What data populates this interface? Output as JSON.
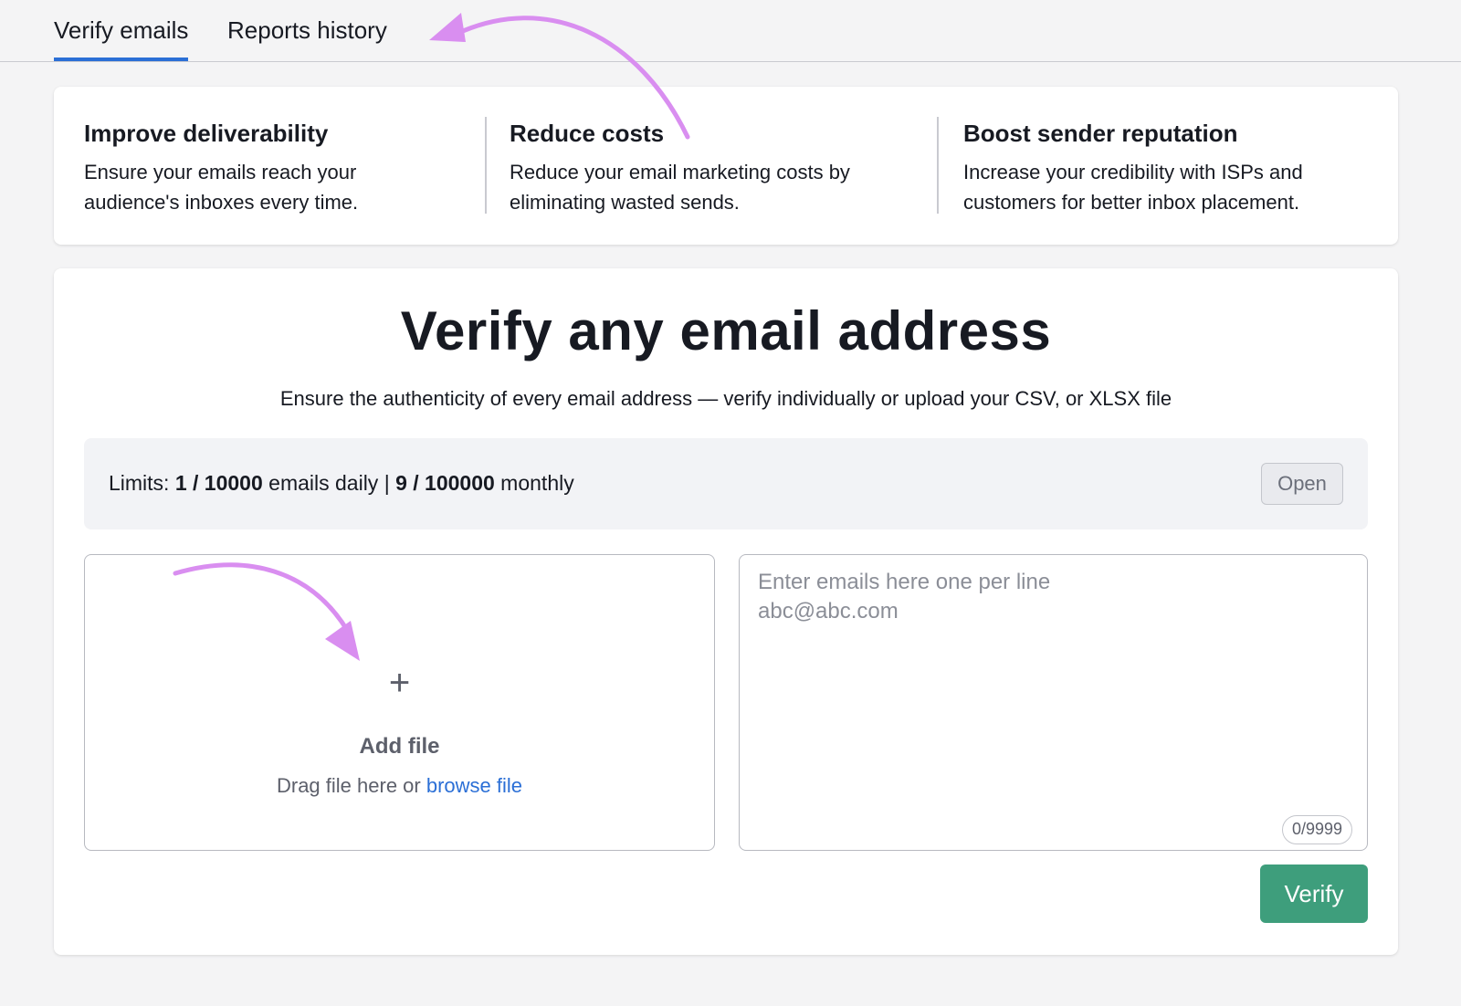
{
  "tabs": [
    {
      "label": "Verify emails",
      "active": true
    },
    {
      "label": "Reports history",
      "active": false
    }
  ],
  "benefits": [
    {
      "title": "Improve deliverability",
      "line1": "Ensure your emails reach your",
      "line2": "audience's inboxes every time."
    },
    {
      "title": "Reduce costs",
      "line1": "Reduce your email marketing costs by",
      "line2": "eliminating wasted sends."
    },
    {
      "title": "Boost sender reputation",
      "line1": "Increase your credibility with ISPs and",
      "line2": "customers for better inbox placement."
    }
  ],
  "main": {
    "title": "Verify any email address",
    "subtitle": "Ensure the authenticity of every email address — verify individually or upload your CSV, or XLSX file"
  },
  "limits": {
    "prefix": "Limits: ",
    "daily_value": "1 / 10000",
    "daily_label": " emails daily | ",
    "monthly_value": "9 / 100000",
    "monthly_label": " monthly",
    "open_label": "Open"
  },
  "upload": {
    "plus_symbol": "+",
    "title": "Add file",
    "drag_text": "Drag file here or ",
    "browse_link": "browse file"
  },
  "emails_input": {
    "placeholder": "Enter emails here one per line\nabc@abc.com",
    "value": "",
    "counter": "0/9999"
  },
  "verify_button": "Verify",
  "colors": {
    "accent_blue": "#2b6fd6",
    "verify_green": "#3e9e7c",
    "annotation_arrow": "#d98ef0"
  },
  "icons": [
    "plus-icon",
    "annotation-arrow"
  ]
}
